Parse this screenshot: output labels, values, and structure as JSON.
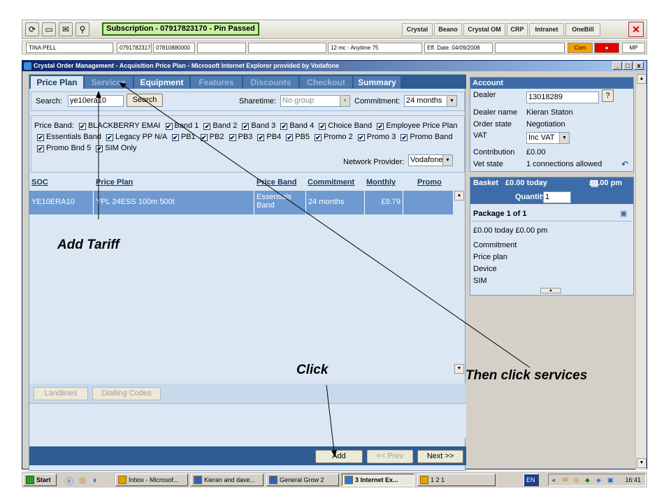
{
  "toolbar": {
    "subscription": "Subscription - 07917823170 - Pin Passed",
    "buttons": [
      "Crystal",
      "Beano",
      "Crystal OM",
      "CRP",
      "Intranet",
      "OneBill"
    ],
    "close": "✕"
  },
  "infobar": {
    "name": "TINA PELL",
    "msisdn": "07917823170",
    "other_number": "07810880000",
    "plan": "12 mc - Anytime 75",
    "eff_date": "Eff. Date: 04/09/2008",
    "com": "Com",
    "mp": "MP",
    "com_color": "#f5a000",
    "alert_color": "#e00000"
  },
  "window": {
    "title": "Crystal Order Management - Acquisition Price Plan - Microsoft Internet Explorer provided by Vodafone",
    "min": "_",
    "max": "□",
    "close": "x"
  },
  "tabs": [
    "Price Plan",
    "Services",
    "Equipment",
    "Features",
    "Discounts",
    "Checkout",
    "Summary"
  ],
  "search": {
    "label": "Search:",
    "value": "ye10era10",
    "button": "Search",
    "sharetime_label": "Sharetime:",
    "sharetime_value": "No group",
    "commitment_label": "Commitment:",
    "commitment_value": "24 months",
    "network_label": "Network Provider:",
    "network_value": "Vodafone"
  },
  "price_bands": {
    "prefix": "Price Band:",
    "items": [
      "BLACKBERRY EMAI",
      "Band 1",
      "Band 2",
      "Band 3",
      "Band 4",
      "Choice Band",
      "Employee Price Plan",
      "Essentials Band",
      "Legacy PP N/A",
      "PB1",
      "PB2",
      "PB3",
      "PB4",
      "PB5",
      "Promo 2",
      "Promo 3",
      "Promo Band",
      "Promo Bnd 5",
      "SIM Only"
    ],
    "check": "✔"
  },
  "grid": {
    "columns": [
      "SOC",
      "Price Plan",
      "Price Band",
      "Commitment",
      "Monthly",
      "Promo"
    ],
    "rows": [
      {
        "soc": "YE10ERA10",
        "plan": "YPL 24ESS 100m 500t",
        "band": "Essentials Band",
        "commitment": "24 months",
        "monthly": "£9.79",
        "promo": ""
      }
    ]
  },
  "lower_buttons": {
    "landlines": "Landlines",
    "dialling": "Dialling Codes"
  },
  "footer": {
    "add": "Add",
    "prev": "<< Prev",
    "next": "Next >>"
  },
  "account": {
    "title": "Account",
    "dealer_label": "Dealer",
    "dealer_value": "13018289",
    "help": "?",
    "dealer_name_label": "Dealer name",
    "dealer_name_value": "Kieran Staton",
    "order_state_label": "Order state",
    "order_state_value": "Negotiation",
    "vat_label": "VAT",
    "vat_value": "Inc VAT",
    "contribution_label": "Contribution",
    "contribution_value": "£0.00",
    "vet_label": "Vet state",
    "vet_value": "1 connections allowed"
  },
  "basket": {
    "title": "Basket",
    "today": "£0.00 today",
    "pm": "£0.00 pm",
    "quantity_label": "Quantity:",
    "quantity_value": "1",
    "package": "Package 1 of 1",
    "summary": "£0.00 today £0.00 pm",
    "lines": [
      "Commitment",
      "Price plan",
      "Device",
      "SIM"
    ]
  },
  "annotations": {
    "add_tariff": "Add Tariff",
    "click": "Click",
    "then_click": "Then click services"
  },
  "taskbar": {
    "start": "Start",
    "tasks": [
      "Inbox - Microsof...",
      "Kieran and dave...",
      "General Grow 2",
      "3 Internet Ex...",
      "1 2 1"
    ],
    "lang": "EN",
    "clock": "16:41"
  }
}
